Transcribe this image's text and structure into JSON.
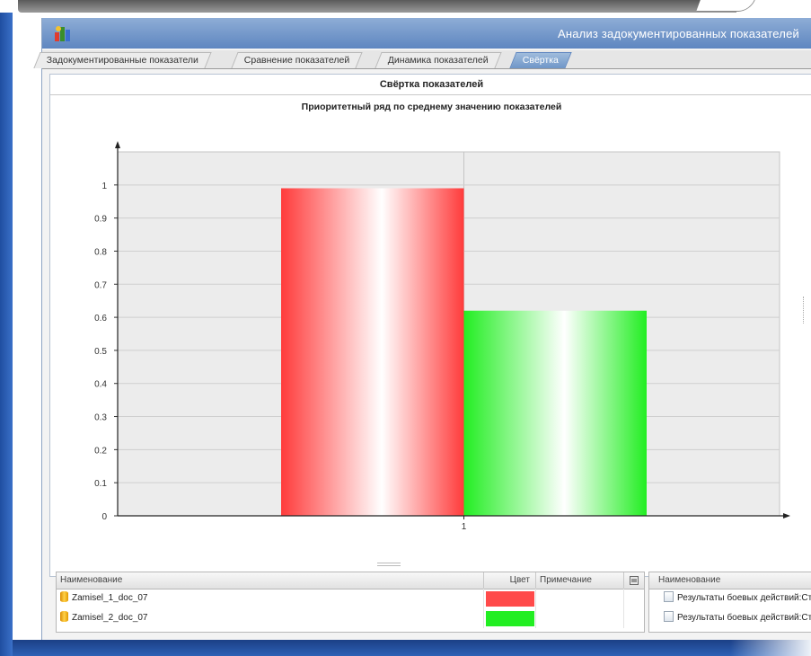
{
  "window": {
    "title": "Анализ задокументированных показателей"
  },
  "tabs": [
    {
      "label": "Задокументированные показатели",
      "active": false
    },
    {
      "label": "Сравнение показателей",
      "active": false
    },
    {
      "label": "Динамика показателей",
      "active": false
    },
    {
      "label": "Свёртка",
      "active": true
    }
  ],
  "panel": {
    "header": "Свёртка показателей"
  },
  "chart_data": {
    "type": "bar",
    "title": "Приоритетный ряд по среднему значению показателей",
    "categories": [
      "1"
    ],
    "series": [
      {
        "values": [
          0.99
        ],
        "color": "#ff3b3b"
      },
      {
        "values": [
          0.62
        ],
        "color": "#22ee22"
      }
    ],
    "ylim": [
      0,
      1.1
    ],
    "yticks": [
      "0",
      "0.1",
      "0.2",
      "0.3",
      "0.4",
      "0.5",
      "0.6",
      "0.7",
      "0.8",
      "0.9",
      "1"
    ],
    "grid": true
  },
  "table_left": {
    "headers": {
      "name": "Наименование",
      "color": "Цвет",
      "note": "Примечание"
    },
    "rows": [
      {
        "name": "Zamisel_1_doc_07",
        "color": "#ff4a4a",
        "note": ""
      },
      {
        "name": "Zamisel_2_doc_07",
        "color": "#22ee22",
        "note": ""
      }
    ]
  },
  "table_right": {
    "headers": {
      "name": "Наименование"
    },
    "rows": [
      {
        "name": "Результаты боевых действий:Ст"
      },
      {
        "name": "Результаты боевых действий:Ст"
      }
    ]
  }
}
